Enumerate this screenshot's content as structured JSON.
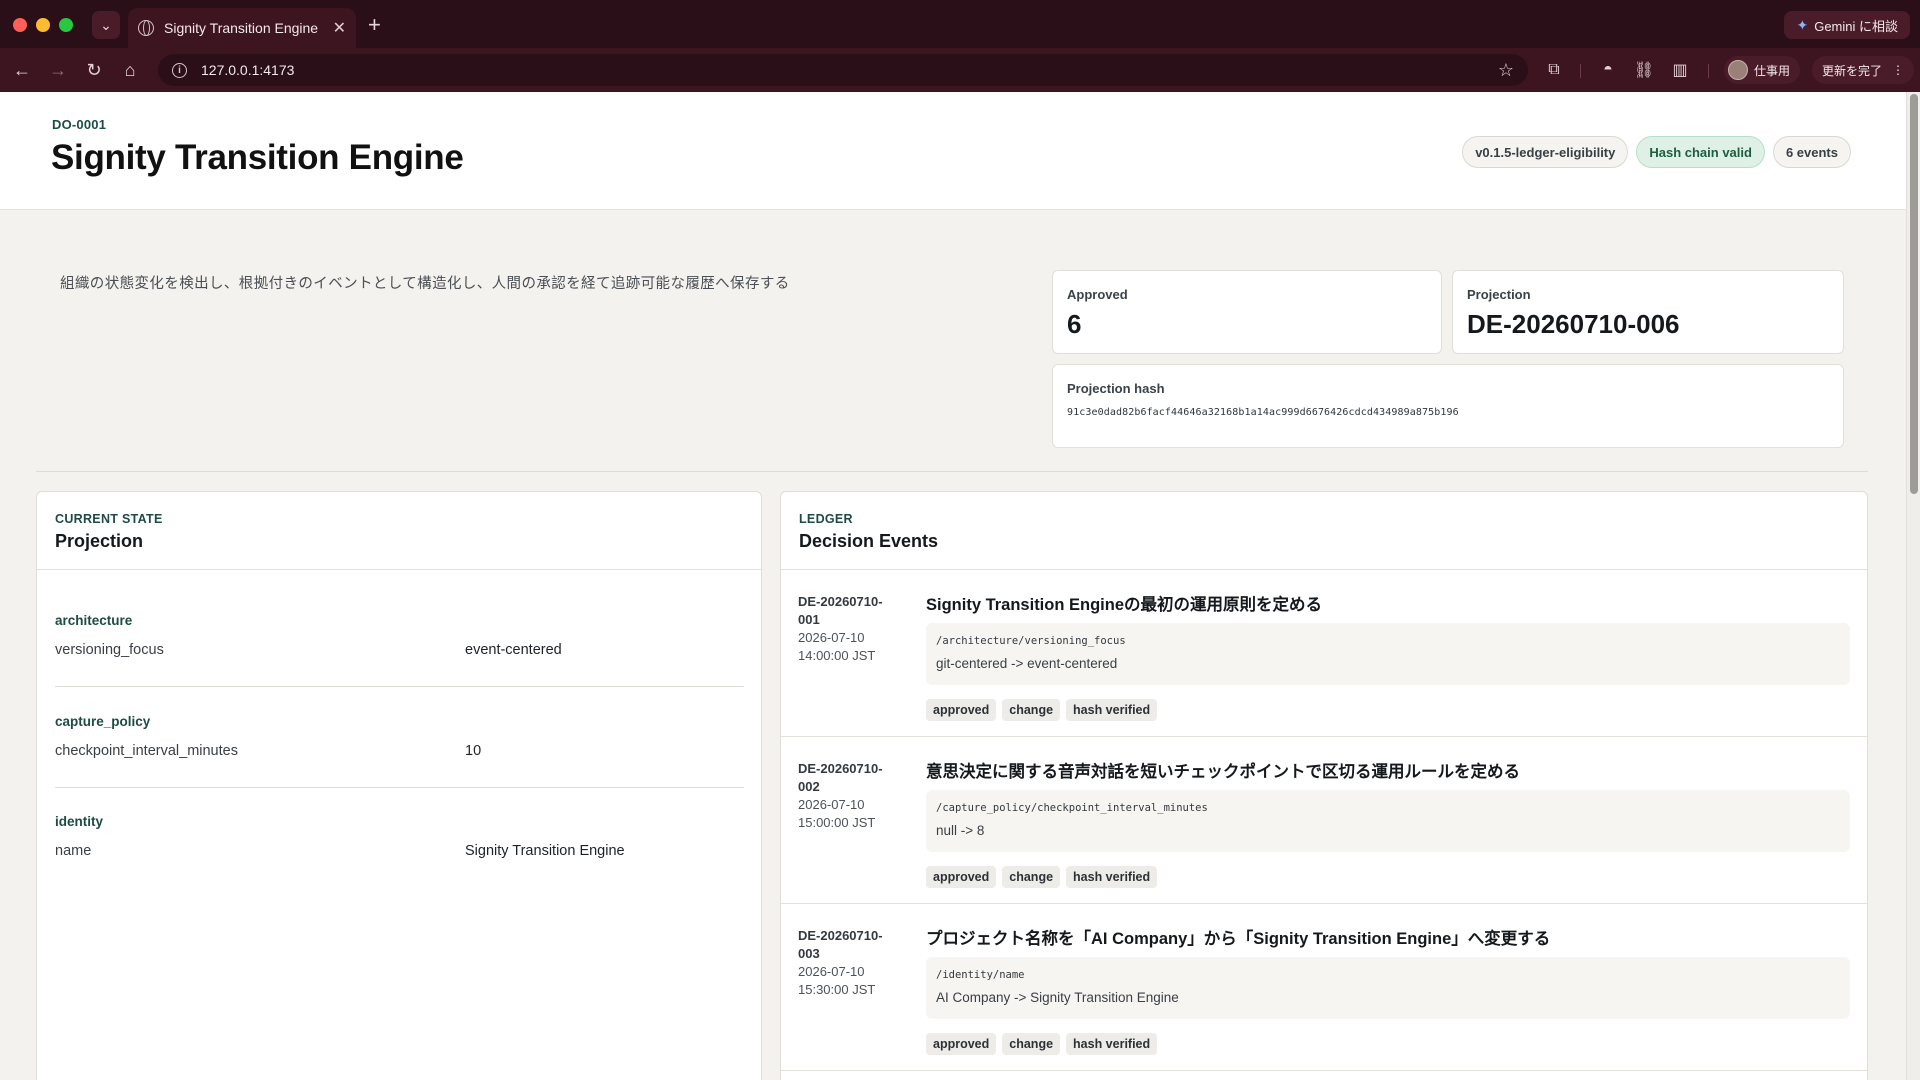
{
  "browser": {
    "tab_title": "Signity Transition Engine",
    "url": "127.0.0.1:4173",
    "gemini_label": "Gemini に相談",
    "profile_label": "仕事用",
    "update_label": "更新を完了",
    "accent": "#3d1521"
  },
  "header": {
    "doc_id": "DO-0001",
    "title": "Signity Transition Engine",
    "badges": {
      "version": "v0.1.5-ledger-eligibility",
      "hash_status": "Hash chain valid",
      "events": "6 events"
    }
  },
  "summary": {
    "description": "組織の状態変化を検出し、根拠付きのイベントとして構造化し、人間の承認を経て追跡可能な履歴へ保存する",
    "approved_label": "Approved",
    "approved_value": "6",
    "projection_label": "Projection",
    "projection_value": "DE-20260710-006",
    "hash_label": "Projection hash",
    "hash_value": "91c3e0dad82b6facf44646a32168b1a14ac999d6676426cdcd434989a875b196"
  },
  "projection_panel": {
    "eyebrow": "CURRENT STATE",
    "title": "Projection",
    "groups": [
      {
        "name": "architecture",
        "key": "versioning_focus",
        "value": "event-centered"
      },
      {
        "name": "capture_policy",
        "key": "checkpoint_interval_minutes",
        "value": "10"
      },
      {
        "name": "identity",
        "key": "name",
        "value": "Signity Transition Engine"
      }
    ]
  },
  "ledger_panel": {
    "eyebrow": "LEDGER",
    "title": "Decision Events",
    "events": [
      {
        "id_line1": "DE-20260710-",
        "id_line2": "001",
        "date": "2026-07-10",
        "time": "14:00:00 JST",
        "title": "Signity Transition Engineの最初の運用原則を定める",
        "path": "/architecture/versioning_focus",
        "diff": "git-centered -> event-centered",
        "tags": [
          "approved",
          "change",
          "hash verified"
        ]
      },
      {
        "id_line1": "DE-20260710-",
        "id_line2": "002",
        "date": "2026-07-10",
        "time": "15:00:00 JST",
        "title": "意思決定に関する音声対話を短いチェックポイントで区切る運用ルールを定める",
        "path": "/capture_policy/checkpoint_interval_minutes",
        "diff": "null -> 8",
        "tags": [
          "approved",
          "change",
          "hash verified"
        ]
      },
      {
        "id_line1": "DE-20260710-",
        "id_line2": "003",
        "date": "2026-07-10",
        "time": "15:30:00 JST",
        "title": "プロジェクト名称を「AI Company」から「Signity Transition Engine」へ変更する",
        "path": "/identity/name",
        "diff": "AI Company -> Signity Transition Engine",
        "tags": [
          "approved",
          "change",
          "hash verified"
        ]
      }
    ]
  }
}
